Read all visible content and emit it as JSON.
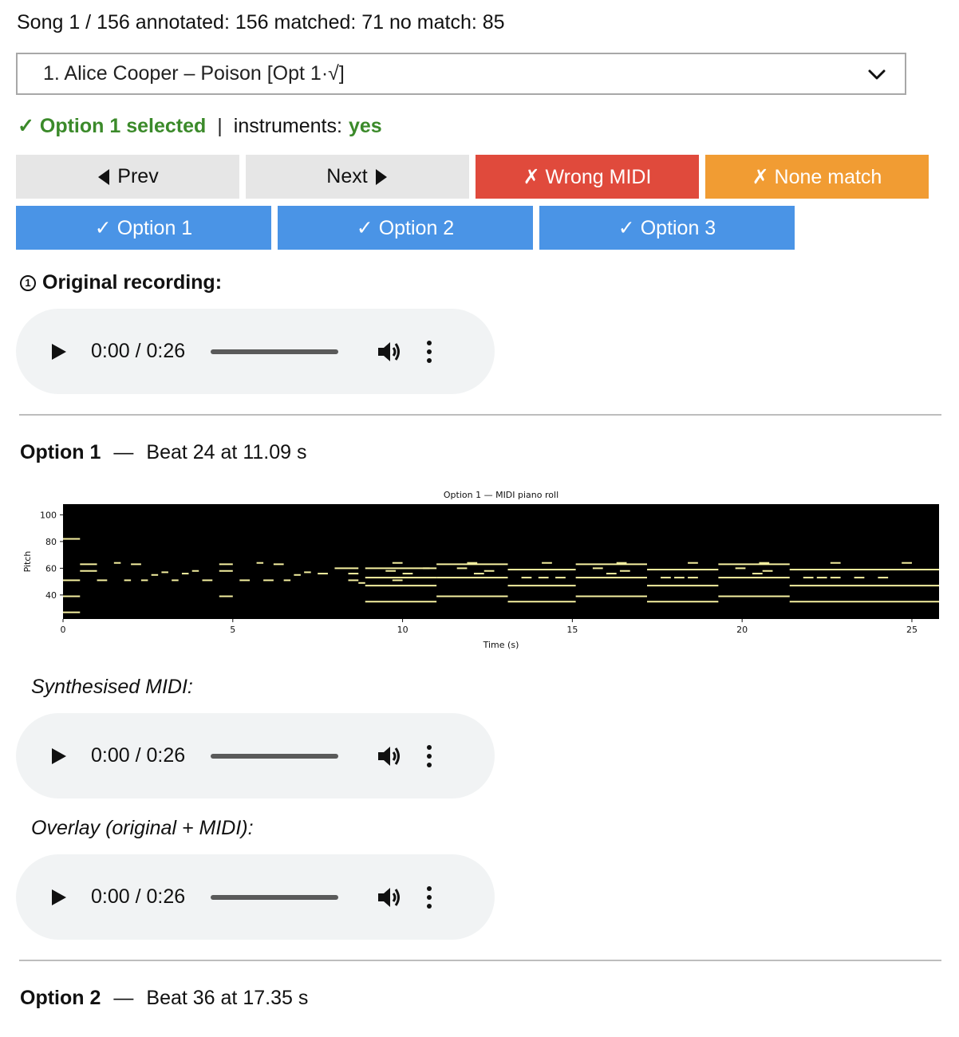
{
  "status": {
    "text": "Song 1 / 156 annotated: 156 matched: 71 no match: 85"
  },
  "song_select": {
    "selected": "1. Alice Cooper – Poison [Opt 1·√]"
  },
  "selection": {
    "selected_label": "✓ Option 1 selected",
    "separator": "|",
    "instruments_label": "instruments:",
    "instruments_value": "yes"
  },
  "nav": {
    "prev": "Prev",
    "next": "Next",
    "wrong_midi": "✗ Wrong MIDI",
    "none_match": "✗ None match"
  },
  "options": [
    "✓ Option 1",
    "✓ Option 2",
    "✓ Option 3"
  ],
  "original": {
    "title": "Original recording:",
    "number": "1",
    "time": "0:00 / 0:26"
  },
  "option1": {
    "name": "Option 1",
    "dash": "—",
    "detail": "Beat 24 at 11.09 s",
    "synth_label": "Synthesised MIDI:",
    "synth_time": "0:00 / 0:26",
    "overlay_label": "Overlay (original + MIDI):",
    "overlay_time": "0:00 / 0:26"
  },
  "option2": {
    "name": "Option 2",
    "dash": "—",
    "detail": "Beat 36 at 17.35 s"
  },
  "colors": {
    "green": "#3b8a2a",
    "red": "#e04a3c",
    "orange": "#f19c33",
    "blue": "#4a94e6",
    "note": "#f5f0a0"
  },
  "chart_data": {
    "type": "heatmap",
    "title": "Option 1 — MIDI piano roll",
    "xlabel": "Time (s)",
    "ylabel": "Pitch",
    "xlim": [
      0,
      25.8
    ],
    "ylim": [
      22,
      108
    ],
    "xticks": [
      0,
      5,
      10,
      15,
      20,
      25
    ],
    "yticks": [
      40,
      60,
      80,
      100
    ],
    "notes": [
      [
        0,
        0.5,
        82
      ],
      [
        0,
        0.5,
        51
      ],
      [
        0,
        0.5,
        39
      ],
      [
        0,
        0.5,
        27
      ],
      [
        0.5,
        1.0,
        63
      ],
      [
        0.5,
        1.0,
        58
      ],
      [
        1.0,
        1.3,
        51
      ],
      [
        1.5,
        1.7,
        64
      ],
      [
        1.8,
        2.0,
        51
      ],
      [
        2.0,
        2.3,
        63
      ],
      [
        2.3,
        2.5,
        51
      ],
      [
        2.6,
        2.8,
        55
      ],
      [
        2.9,
        3.1,
        57
      ],
      [
        3.2,
        3.4,
        51
      ],
      [
        3.5,
        3.7,
        56
      ],
      [
        3.8,
        4.0,
        58
      ],
      [
        4.1,
        4.4,
        51
      ],
      [
        4.6,
        5.0,
        63
      ],
      [
        4.6,
        5.0,
        58
      ],
      [
        4.6,
        5.0,
        39
      ],
      [
        5.2,
        5.5,
        51
      ],
      [
        5.7,
        5.9,
        64
      ],
      [
        5.9,
        6.2,
        51
      ],
      [
        6.2,
        6.5,
        63
      ],
      [
        6.5,
        6.7,
        51
      ],
      [
        6.8,
        7.0,
        55
      ],
      [
        7.1,
        7.3,
        57
      ],
      [
        7.5,
        7.8,
        56
      ],
      [
        8.0,
        8.4,
        60
      ],
      [
        8.4,
        8.7,
        60
      ],
      [
        8.4,
        8.7,
        56
      ],
      [
        8.4,
        8.7,
        51
      ],
      [
        8.7,
        8.9,
        49
      ],
      [
        8.9,
        11.0,
        60
      ],
      [
        8.9,
        11.0,
        53
      ],
      [
        8.9,
        11.0,
        47
      ],
      [
        8.9,
        11.0,
        35
      ],
      [
        9.5,
        9.8,
        58
      ],
      [
        9.7,
        10.0,
        51
      ],
      [
        10.0,
        10.3,
        56
      ],
      [
        10.6,
        10.8,
        60
      ],
      [
        11.0,
        13.1,
        63
      ],
      [
        11.0,
        13.1,
        53
      ],
      [
        11.0,
        13.1,
        39
      ],
      [
        11.6,
        11.9,
        60
      ],
      [
        12.1,
        12.4,
        56
      ],
      [
        12.4,
        12.7,
        58
      ],
      [
        13.1,
        15.1,
        59
      ],
      [
        13.1,
        15.1,
        47
      ],
      [
        13.1,
        15.1,
        35
      ],
      [
        13.5,
        13.8,
        53
      ],
      [
        14.0,
        14.3,
        53
      ],
      [
        14.5,
        14.8,
        53
      ],
      [
        15.1,
        17.2,
        63
      ],
      [
        15.1,
        17.2,
        53
      ],
      [
        15.1,
        17.2,
        39
      ],
      [
        15.6,
        15.9,
        60
      ],
      [
        16.0,
        16.3,
        56
      ],
      [
        16.4,
        16.7,
        58
      ],
      [
        17.2,
        19.3,
        59
      ],
      [
        17.2,
        19.3,
        47
      ],
      [
        17.2,
        19.3,
        35
      ],
      [
        17.6,
        17.9,
        53
      ],
      [
        18.0,
        18.3,
        53
      ],
      [
        18.4,
        18.7,
        53
      ],
      [
        19.3,
        21.4,
        63
      ],
      [
        19.3,
        21.4,
        53
      ],
      [
        19.3,
        21.4,
        39
      ],
      [
        19.8,
        20.1,
        60
      ],
      [
        20.3,
        20.6,
        56
      ],
      [
        20.6,
        20.9,
        58
      ],
      [
        21.4,
        25.8,
        59
      ],
      [
        21.4,
        25.8,
        47
      ],
      [
        21.4,
        25.8,
        35
      ],
      [
        21.8,
        22.1,
        53
      ],
      [
        22.2,
        22.5,
        53
      ],
      [
        22.6,
        22.9,
        53
      ],
      [
        23.3,
        23.6,
        53
      ],
      [
        24.0,
        24.3,
        53
      ],
      [
        9.7,
        10.0,
        64
      ],
      [
        11.9,
        12.2,
        64
      ],
      [
        14.1,
        14.4,
        64
      ],
      [
        16.3,
        16.6,
        64
      ],
      [
        18.4,
        18.7,
        64
      ],
      [
        20.5,
        20.8,
        64
      ],
      [
        22.6,
        22.9,
        64
      ],
      [
        24.7,
        25.0,
        64
      ]
    ]
  }
}
